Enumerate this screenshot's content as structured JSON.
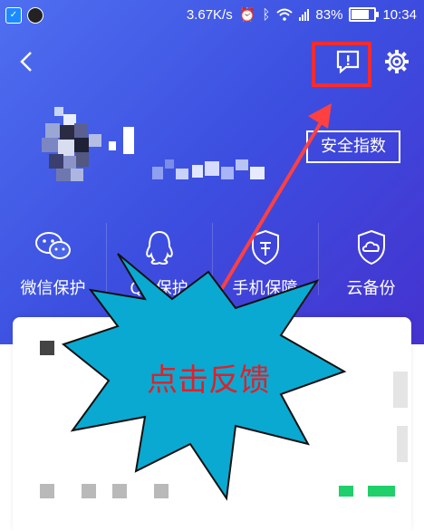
{
  "status_bar": {
    "speed": "3.67K/s",
    "battery_percent": "83%",
    "time": "10:34",
    "icons": [
      "security-app-icon",
      "qq-notification-icon",
      "alarm-icon",
      "bluetooth-icon",
      "wifi-icon",
      "signal-icon",
      "battery-icon"
    ]
  },
  "header": {
    "back_icon": "chevron-left-icon",
    "feedback_icon": "feedback-icon",
    "settings_icon": "gear-icon"
  },
  "profile": {
    "security_score_button": "安全指数"
  },
  "features": [
    {
      "icon": "wechat-icon",
      "label": "微信保护"
    },
    {
      "icon": "qq-icon",
      "label": "QQ保护"
    },
    {
      "icon": "phone-shield-icon",
      "label": "手机保障"
    },
    {
      "icon": "cloud-shield-icon",
      "label": "云备份"
    }
  ],
  "annotation": {
    "text": "点击反馈",
    "highlight_color": "#ff2a2a",
    "burst_color": "#0aa9d1",
    "text_color": "#e0202a"
  },
  "colors": {
    "header_gradient_start": "#4f6ff0",
    "header_gradient_end": "#4532cf"
  }
}
